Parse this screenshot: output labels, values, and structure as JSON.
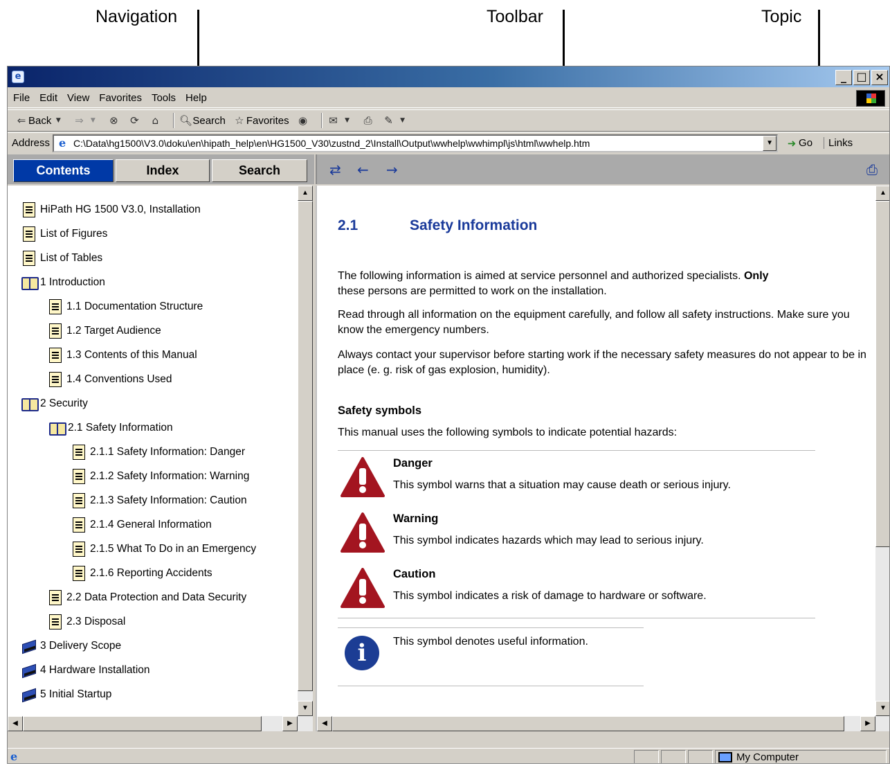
{
  "callouts": {
    "navigation": "Navigation",
    "toolbar": "Toolbar",
    "topic": "Topic"
  },
  "window": {
    "menu": [
      "File",
      "Edit",
      "View",
      "Favorites",
      "Tools",
      "Help"
    ],
    "toolbar": {
      "back": "Back",
      "search": "Search",
      "favorites": "Favorites"
    },
    "address": {
      "label": "Address",
      "value": "C:\\Data\\hg1500\\V3.0\\doku\\en\\hipath_help\\en\\HG1500_V30\\zustnd_2\\Install\\Output\\wwhelp\\wwhimpl\\js\\html\\wwhelp.htm",
      "go": "Go",
      "links": "Links"
    },
    "status": {
      "zone": "My Computer"
    }
  },
  "nav": {
    "tabs": {
      "contents": "Contents",
      "index": "Index",
      "search": "Search"
    },
    "toc": [
      {
        "icon": "page",
        "label": "HiPath HG 1500 V3.0, Installation"
      },
      {
        "icon": "page",
        "label": "List of Figures"
      },
      {
        "icon": "page",
        "label": "List of Tables"
      },
      {
        "icon": "book-open",
        "label": "1 Introduction"
      },
      {
        "icon": "page",
        "label": "1.1 Documentation Structure"
      },
      {
        "icon": "page",
        "label": "1.2 Target Audience"
      },
      {
        "icon": "page",
        "label": "1.3 Contents of this Manual"
      },
      {
        "icon": "page",
        "label": "1.4 Conventions Used"
      },
      {
        "icon": "book-open",
        "label": "2 Security"
      },
      {
        "icon": "book-open",
        "label": "2.1 Safety Information"
      },
      {
        "icon": "page",
        "label": "2.1.1 Safety Information: Danger"
      },
      {
        "icon": "page",
        "label": "2.1.2 Safety Information: Warning"
      },
      {
        "icon": "page",
        "label": "2.1.3 Safety Information: Caution"
      },
      {
        "icon": "page",
        "label": "2.1.4 General Information"
      },
      {
        "icon": "page",
        "label": "2.1.5 What To Do in an Emergency"
      },
      {
        "icon": "page",
        "label": "2.1.6 Reporting Accidents"
      },
      {
        "icon": "page",
        "label": "2.2 Data Protection and Data Security"
      },
      {
        "icon": "page",
        "label": "2.3 Disposal"
      },
      {
        "icon": "book-closed",
        "label": "3 Delivery Scope"
      },
      {
        "icon": "book-closed",
        "label": "4 Hardware Installation"
      },
      {
        "icon": "book-closed",
        "label": "5 Initial Startup"
      }
    ]
  },
  "topic": {
    "number": "2.1",
    "title": "Safety Information",
    "para1_a": "The following information is aimed at service personnel and authorized specialists. ",
    "para1_bold": "Only",
    "para1_b": "these persons are permitted to work on the installation.",
    "para2": "Read through all information on the equipment carefully, and follow all safety instructions. Make sure you know the emergency numbers.",
    "para3": "Always contact your supervisor before starting work if the necessary safety measures do not appear to be in place (e. g. risk of gas explosion, humidity).",
    "symbols_heading": "Safety symbols",
    "symbols_intro": "This manual uses the following symbols to indicate potential hazards:",
    "danger_title": "Danger",
    "danger_text": "This symbol warns that a situation may cause death or serious injury.",
    "warning_title": "Warning",
    "warning_text": "This symbol indicates hazards which may lead to serious injury.",
    "caution_title": "Caution",
    "caution_text": "This symbol indicates a risk of damage to hardware or software.",
    "info_text": "This symbol denotes useful information."
  },
  "colors": {
    "tab_active": "#0039a6",
    "heading_blue": "#1a3a9a",
    "warning_red": "#a31520",
    "info_blue": "#1c3d94"
  }
}
